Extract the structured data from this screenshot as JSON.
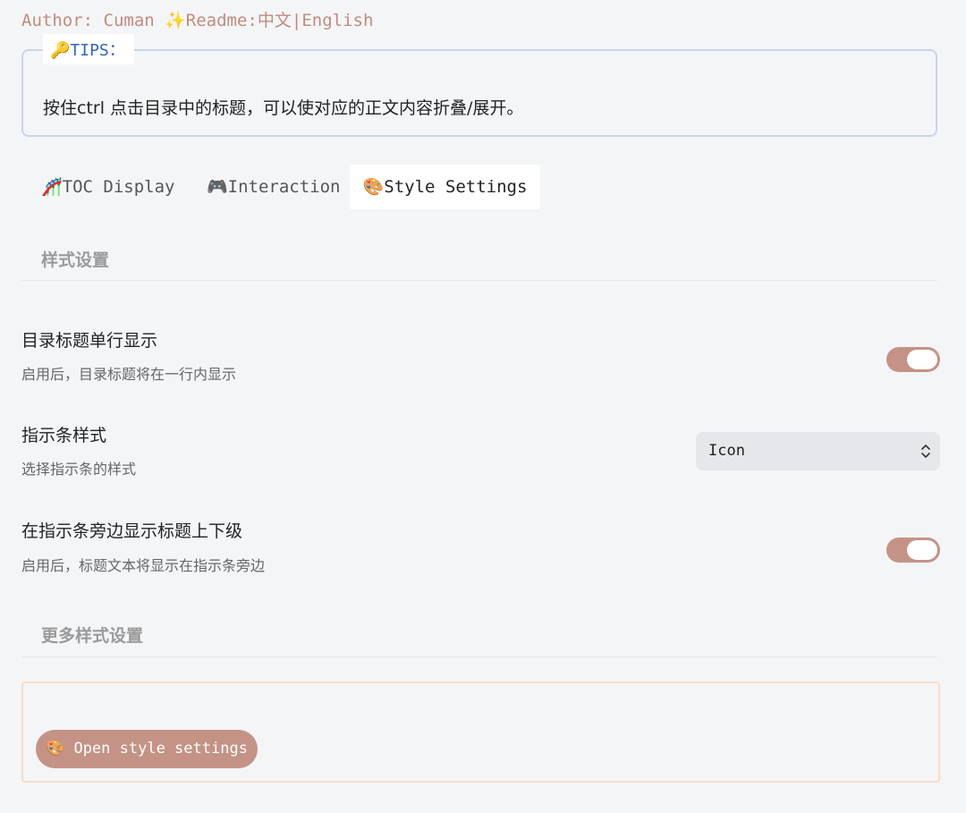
{
  "header": {
    "author": "Author: Cuman ✨Readme:中文|English"
  },
  "tips": {
    "legend": "🔑TIPS：",
    "text": "按住ctrl 点击目录中的标题，可以使对应的正文内容折叠/展开。"
  },
  "tabs": [
    {
      "label": "🎢TOC Display",
      "active": false
    },
    {
      "label": "🎮Interaction",
      "active": false
    },
    {
      "label": "🎨Style Settings",
      "active": true
    }
  ],
  "style_section": {
    "heading": "样式设置",
    "settings": [
      {
        "name": "目录标题单行显示",
        "desc": "启用后，目录标题将在一行内显示",
        "control": "toggle",
        "enabled": true
      },
      {
        "name": "指示条样式",
        "desc": "选择指示条的样式",
        "control": "select",
        "selected": "Icon"
      },
      {
        "name": "在指示条旁边显示标题上下级",
        "desc": "启用后，标题文本将显示在指示条旁边",
        "control": "toggle",
        "enabled": true
      }
    ]
  },
  "more_section": {
    "heading": "更多样式设置",
    "button_label": "🎨 Open style settings"
  },
  "colors": {
    "accent": "#c49386",
    "author_text": "#c08c7c",
    "tips_border": "#c9d4ec",
    "tips_label": "#2f66c2",
    "more_border": "#f6dcc7"
  }
}
